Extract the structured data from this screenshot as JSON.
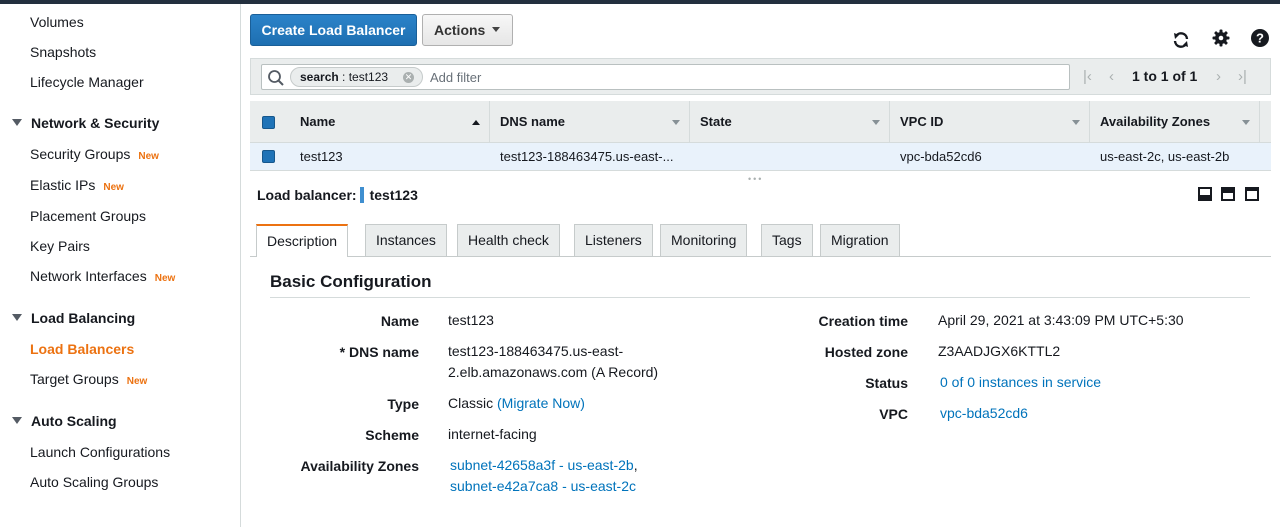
{
  "sidebar": {
    "top_items": [
      {
        "label": "Volumes"
      },
      {
        "label": "Snapshots"
      },
      {
        "label": "Lifecycle Manager"
      }
    ],
    "sections": [
      {
        "heading": "Network & Security",
        "items": [
          {
            "label": "Security Groups",
            "badge": "New"
          },
          {
            "label": "Elastic IPs",
            "badge": "New"
          },
          {
            "label": "Placement Groups",
            "badge": ""
          },
          {
            "label": "Key Pairs",
            "badge": ""
          },
          {
            "label": "Network Interfaces",
            "badge": "New"
          }
        ]
      },
      {
        "heading": "Load Balancing",
        "items": [
          {
            "label": "Load Balancers",
            "badge": "",
            "active": true
          },
          {
            "label": "Target Groups",
            "badge": "New"
          }
        ]
      },
      {
        "heading": "Auto Scaling",
        "items": [
          {
            "label": "Launch Configurations",
            "badge": ""
          },
          {
            "label": "Auto Scaling Groups",
            "badge": ""
          }
        ]
      }
    ]
  },
  "toolbar": {
    "create_label": "Create Load Balancer",
    "actions_label": "Actions",
    "icons": [
      "refresh-icon",
      "gear-icon",
      "help-icon"
    ]
  },
  "filter": {
    "token_key": "search",
    "token_value": "test123",
    "placeholder": "Add filter",
    "pagination": "1 to 1 of 1"
  },
  "table": {
    "columns": [
      "Name",
      "DNS name",
      "State",
      "VPC ID",
      "Availability Zones"
    ],
    "rows": [
      {
        "name": "test123",
        "dns": "test123-188463475.us-east-...",
        "state": "",
        "vpc": "vpc-bda52cd6",
        "zones": "us-east-2c, us-east-2b"
      }
    ]
  },
  "details": {
    "title_label": "Load balancer:",
    "title_value": "test123",
    "tabs": [
      "Description",
      "Instances",
      "Health check",
      "Listeners",
      "Monitoring",
      "Tags",
      "Migration"
    ],
    "section_title": "Basic Configuration",
    "left": {
      "name_label": "Name",
      "name_value": "test123",
      "dns_label": "* DNS name",
      "dns_line1": "test123-188463475.us-east-",
      "dns_line2": "2.elb.amazonaws.com (A Record)",
      "type_label": "Type",
      "type_value": "Classic",
      "type_link": "(Migrate Now)",
      "scheme_label": "Scheme",
      "scheme_value": "internet-facing",
      "az_label": "Availability Zones",
      "az_link1": "subnet-42658a3f - us-east-2b",
      "az_sep": ",",
      "az_link2": "subnet-e42a7ca8 - us-east-2c"
    },
    "right": {
      "creation_label": "Creation time",
      "creation_value": "April 29, 2021 at 3:43:09 PM UTC+5:30",
      "hosted_label": "Hosted zone",
      "hosted_value": "Z3AADJGX6KTTL2",
      "status_label": "Status",
      "status_link": "0 of 0 instances in service",
      "vpc_label": "VPC",
      "vpc_link": "vpc-bda52cd6"
    }
  },
  "colors": {
    "accent": "#ec7211",
    "primary_button": "#1f73b7",
    "link": "#0073bb"
  }
}
